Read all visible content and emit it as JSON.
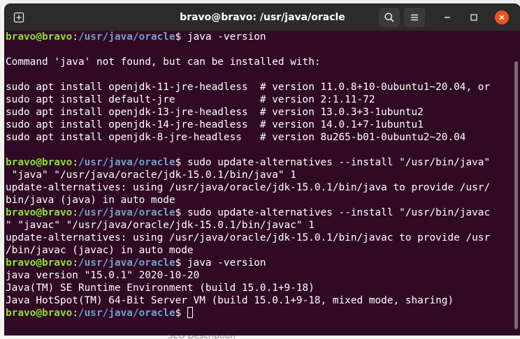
{
  "window": {
    "title": "bravo@bravo: /usr/java/oracle"
  },
  "background": {
    "peek_text": "SEO Description"
  },
  "prompt": {
    "user_host": "bravo@bravo",
    "separator": ":",
    "path": "/usr/java/oracle",
    "symbol": "$ "
  },
  "terminal": {
    "lines": [
      {
        "type": "prompt",
        "cmd": "java -version"
      },
      {
        "type": "text",
        "text": ""
      },
      {
        "type": "text",
        "text": "Command 'java' not found, but can be installed with:"
      },
      {
        "type": "text",
        "text": ""
      },
      {
        "type": "text",
        "text": "sudo apt install openjdk-11-jre-headless  # version 11.0.8+10-0ubuntu1~20.04, or"
      },
      {
        "type": "text",
        "text": "sudo apt install default-jre              # version 2:1.11-72"
      },
      {
        "type": "text",
        "text": "sudo apt install openjdk-13-jre-headless  # version 13.0.3+3-1ubuntu2"
      },
      {
        "type": "text",
        "text": "sudo apt install openjdk-14-jre-headless  # version 14.0.1+7-1ubuntu1"
      },
      {
        "type": "text",
        "text": "sudo apt install openjdk-8-jre-headless   # version 8u265-b01-0ubuntu2~20.04"
      },
      {
        "type": "text",
        "text": ""
      },
      {
        "type": "prompt",
        "cmd": "sudo update-alternatives --install \"/usr/bin/java\""
      },
      {
        "type": "text",
        "text": " \"java\" \"/usr/java/oracle/jdk-15.0.1/bin/java\" 1"
      },
      {
        "type": "text",
        "text": "update-alternatives: using /usr/java/oracle/jdk-15.0.1/bin/java to provide /usr/"
      },
      {
        "type": "text",
        "text": "bin/java (java) in auto mode"
      },
      {
        "type": "prompt",
        "cmd": "sudo update-alternatives --install \"/usr/bin/javac"
      },
      {
        "type": "text",
        "text": "\" \"javac\" \"/usr/java/oracle/jdk-15.0.1/bin/javac\" 1"
      },
      {
        "type": "text",
        "text": "update-alternatives: using /usr/java/oracle/jdk-15.0.1/bin/javac to provide /usr"
      },
      {
        "type": "text",
        "text": "/bin/javac (javac) in auto mode"
      },
      {
        "type": "prompt",
        "cmd": "java -version"
      },
      {
        "type": "text",
        "text": "java version \"15.0.1\" 2020-10-20"
      },
      {
        "type": "text",
        "text": "Java(TM) SE Runtime Environment (build 15.0.1+9-18)"
      },
      {
        "type": "text",
        "text": "Java HotSpot(TM) 64-Bit Server VM (build 15.0.1+9-18, mixed mode, sharing)"
      },
      {
        "type": "prompt",
        "cmd": "",
        "cursor": true
      }
    ]
  },
  "icons": {
    "new_tab": "new-tab-icon",
    "search": "search-icon",
    "menu": "hamburger-menu-icon",
    "minimize": "minimize-icon",
    "maximize": "maximize-icon",
    "close": "close-icon"
  },
  "colors": {
    "terminal_bg": "#300a24",
    "titlebar_bg": "#2b2b2b",
    "prompt_user": "#8ae234",
    "prompt_path": "#729fcf",
    "close_button": "#e95420"
  }
}
